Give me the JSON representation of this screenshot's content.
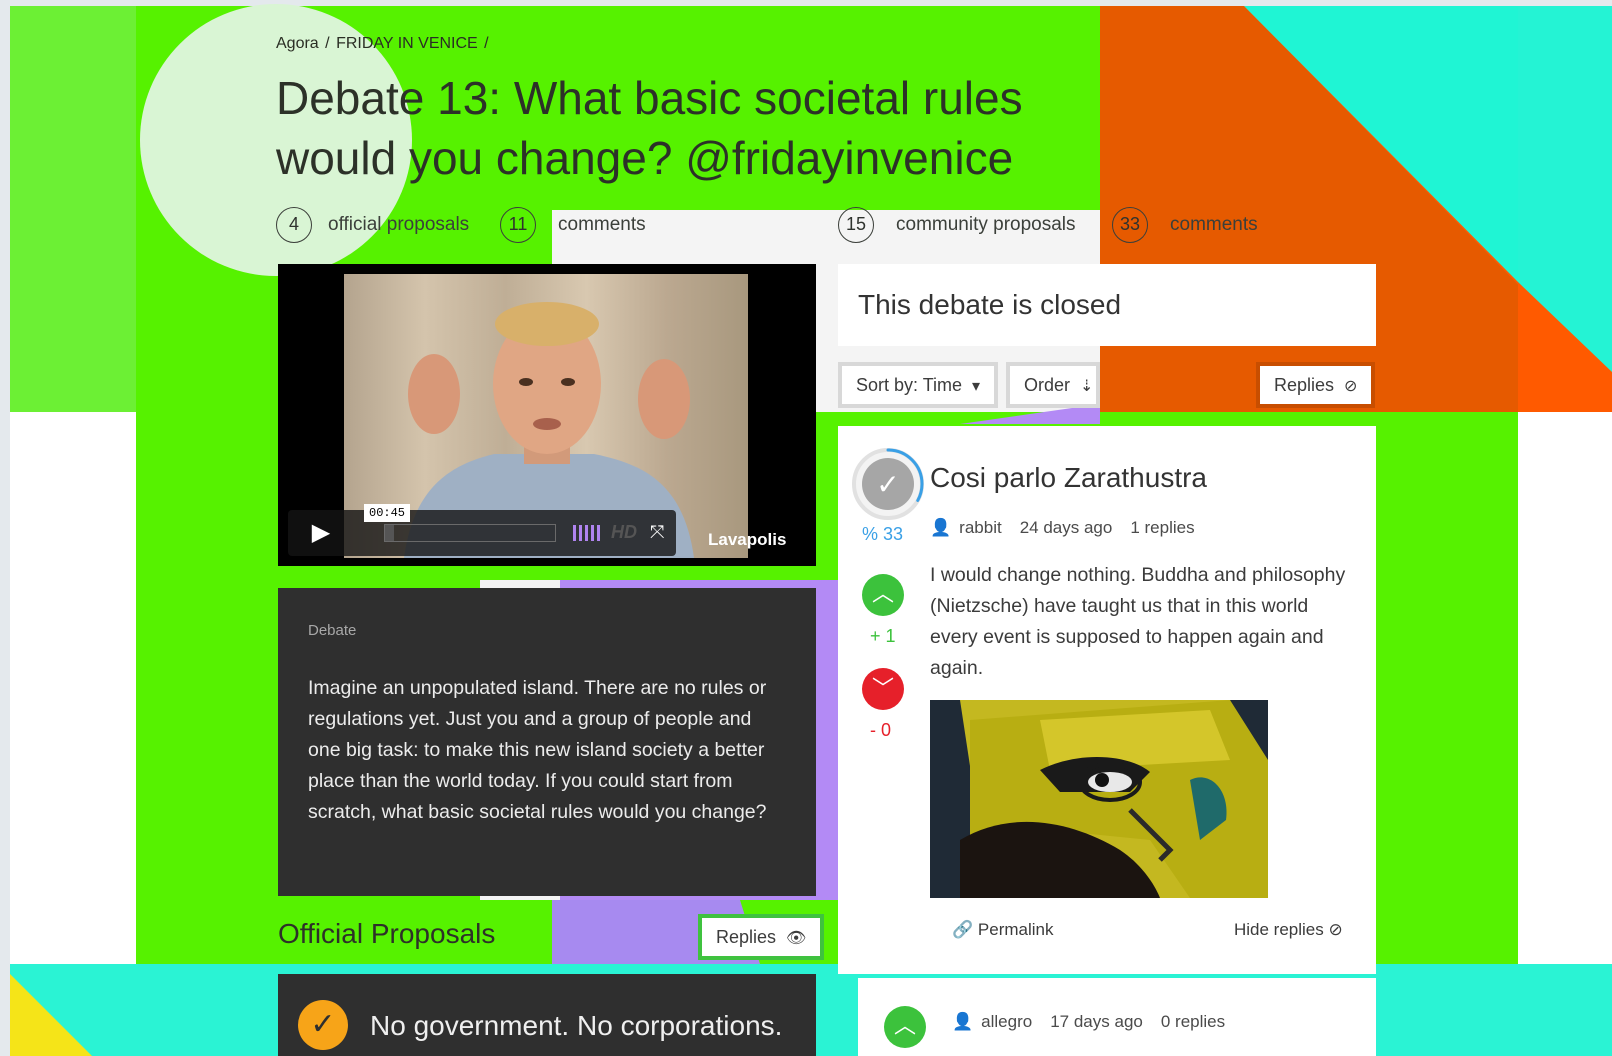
{
  "breadcrumb": [
    "Agora",
    "/",
    "FRIDAY IN VENICE",
    "/"
  ],
  "title": "Debate 13: What basic societal rules would you change? @fridayinvenice",
  "stats": {
    "official_count": "4",
    "official_label": "official proposals",
    "official_comments_count": "11",
    "official_comments_label": "comments",
    "community_count": "15",
    "community_label": "community proposals",
    "community_comments_count": "33",
    "community_comments_label": "comments"
  },
  "video": {
    "timestamp": "00:45",
    "quality": "HD",
    "brand": "Lavapolis",
    "progress": 0.05
  },
  "debate": {
    "label": "Debate",
    "text": "Imagine an unpopulated island. There are no rules or regulations yet. Just you and a group of people and one big task: to make this new island society a better place than the world today. If you could start from scratch, what basic societal rules would you change?"
  },
  "official": {
    "heading": "Official Proposals",
    "replies_button": "Replies",
    "first_proposal": "No government. No corporations."
  },
  "closed_notice": "This debate is closed",
  "toolbar": {
    "sort_label": "Sort by: Time",
    "order_label": "Order",
    "replies_label": "Replies"
  },
  "comment": {
    "percent": "% 33",
    "percent_value": 33,
    "up_votes": "+ 1",
    "down_votes": "- 0",
    "title": "Cosi parlo Zarathustra",
    "author": "rabbit",
    "age": "24 days ago",
    "replies": "1 replies",
    "body": "I would change nothing. Buddha and philosophy (Nietzsche) have taught us that in this world every event is supposed to happen again and again.",
    "permalink_label": "Permalink",
    "hide_replies_label": "Hide replies"
  },
  "reply": {
    "author": "allegro",
    "age": "17 days ago",
    "replies": "0 replies"
  },
  "colors": {
    "green": "#56f200",
    "orange": "#e65a00",
    "cyan": "#1ff5d4",
    "purple": "#b38af5",
    "vote_up": "#3cc23c",
    "vote_down": "#e6202a",
    "accent_blue": "#3aa0e6",
    "proposal_check": "#f7a418"
  }
}
